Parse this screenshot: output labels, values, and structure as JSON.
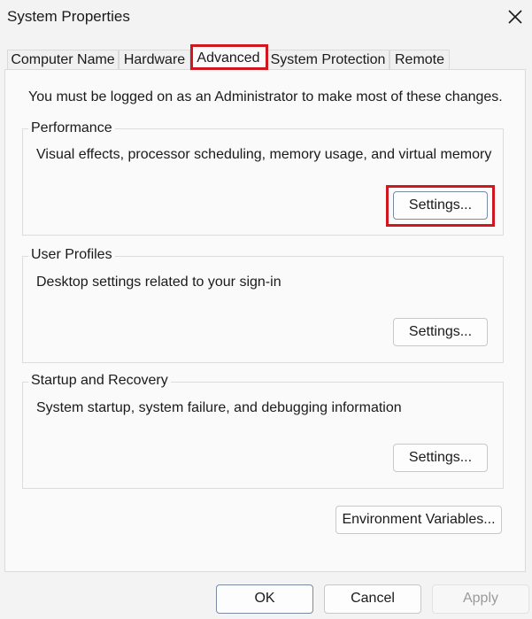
{
  "window": {
    "title": "System Properties"
  },
  "tabs": [
    {
      "label": "Computer Name"
    },
    {
      "label": "Hardware"
    },
    {
      "label": "Advanced"
    },
    {
      "label": "System Protection"
    },
    {
      "label": "Remote"
    }
  ],
  "active_tab": "Advanced",
  "notice": "You must be logged on as an Administrator to make most of these changes.",
  "groups": [
    {
      "title": "Performance",
      "description": "Visual effects, processor scheduling, memory usage, and virtual memory",
      "button": "Settings..."
    },
    {
      "title": "User Profiles",
      "description": "Desktop settings related to your sign-in",
      "button": "Settings..."
    },
    {
      "title": "Startup and Recovery",
      "description": "System startup, system failure, and debugging information",
      "button": "Settings..."
    }
  ],
  "env_button": "Environment Variables...",
  "footer": {
    "ok": "OK",
    "cancel": "Cancel",
    "apply": "Apply"
  },
  "colors": {
    "highlight": "#d0161e",
    "background": "#f3f3f3",
    "panel": "#fafafa"
  },
  "icons": {
    "close": "close-icon"
  }
}
